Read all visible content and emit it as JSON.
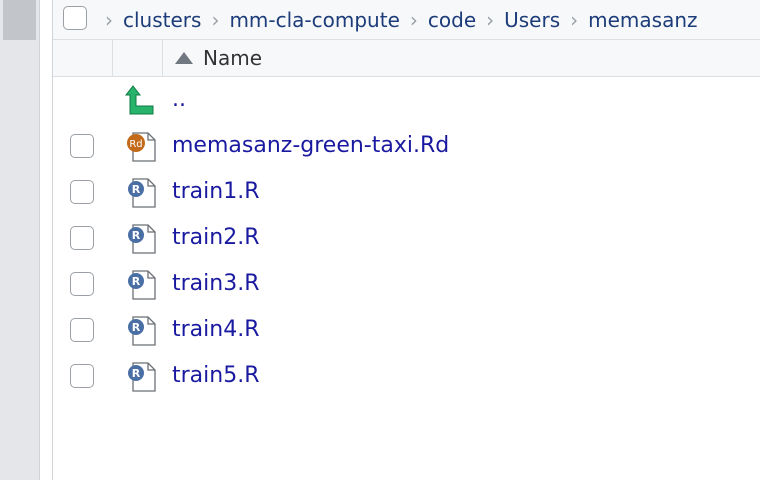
{
  "breadcrumb": {
    "items": [
      "clusters",
      "mm-cla-compute",
      "code",
      "Users",
      "memasanz"
    ]
  },
  "header": {
    "sort_column": "Name"
  },
  "files": [
    {
      "name": "..",
      "icon": "parent-folder-up-arrow-icon"
    },
    {
      "name": "memasanz-green-taxi.Rd",
      "icon": "rd-file-icon"
    },
    {
      "name": "train1.R",
      "icon": "r-file-icon"
    },
    {
      "name": "train2.R",
      "icon": "r-file-icon"
    },
    {
      "name": "train3.R",
      "icon": "r-file-icon"
    },
    {
      "name": "train4.R",
      "icon": "r-file-icon"
    },
    {
      "name": "train5.R",
      "icon": "r-file-icon"
    }
  ],
  "colors": {
    "link": "#1a1aa0",
    "breadcrumb": "#1c3c7a",
    "up_arrow": "#27b36a",
    "r_badge": "#4a6fa5",
    "rd_badge": "#c26a1a"
  }
}
